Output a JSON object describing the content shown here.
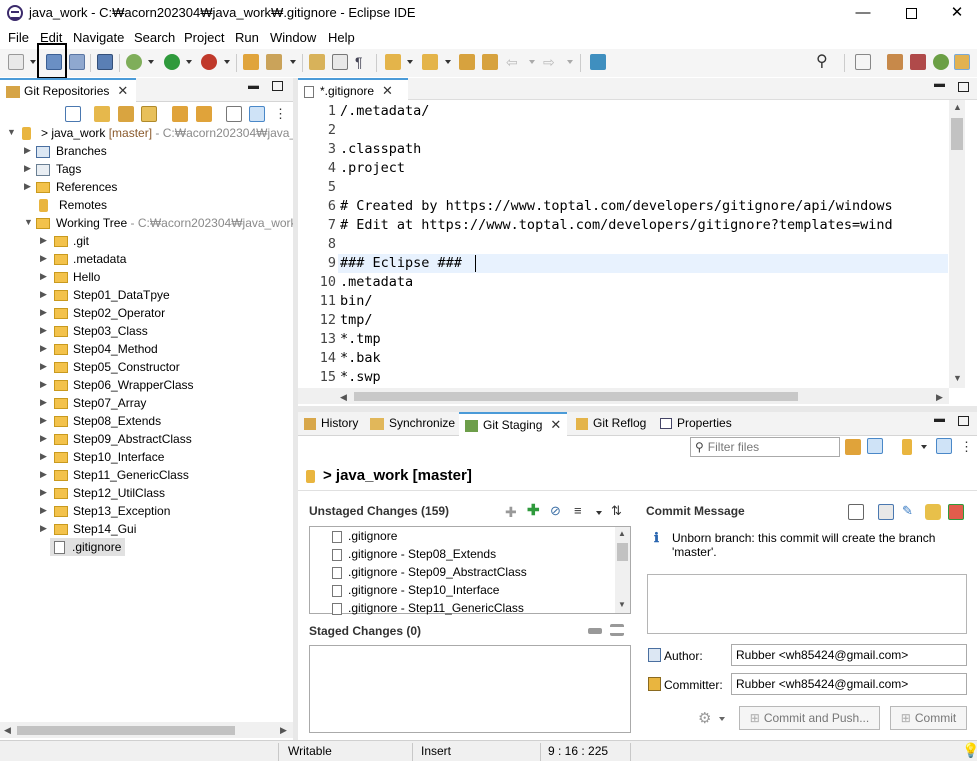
{
  "window": {
    "title": "java_work - C:₩acorn202304₩java_work₩.gitignore - Eclipse IDE"
  },
  "menu": [
    "File",
    "Edit",
    "Navigate",
    "Search",
    "Project",
    "Run",
    "Window",
    "Help"
  ],
  "left_panel": {
    "tab_label": "Git Repositories",
    "repo": {
      "name": "java_work",
      "branch": "[master]",
      "path": "- C:₩acorn202304₩java_"
    },
    "nodes": [
      {
        "label": "Branches"
      },
      {
        "label": "Tags"
      },
      {
        "label": "References"
      },
      {
        "label": "Remotes"
      }
    ],
    "working_tree": {
      "label": "Working Tree",
      "path": "- C:₩acorn202304₩java_work"
    },
    "folders": [
      ".git",
      ".metadata",
      "Hello",
      "Step01_DataTpye",
      "Step02_Operator",
      "Step03_Class",
      "Step04_Method",
      "Step05_Constructor",
      "Step06_WrapperClass",
      "Step07_Array",
      "Step08_Extends",
      "Step09_AbstractClass",
      "Step10_Interface",
      "Step11_GenericClass",
      "Step12_UtilClass",
      "Step13_Exception",
      "Step14_Gui"
    ],
    "selected_file": ".gitignore"
  },
  "editor": {
    "tab_label": "*.gitignore",
    "lines": [
      {
        "n": "1",
        "t": "/.metadata/"
      },
      {
        "n": "2",
        "t": ""
      },
      {
        "n": "3",
        "t": ".classpath"
      },
      {
        "n": "4",
        "t": ".project"
      },
      {
        "n": "5",
        "t": ""
      },
      {
        "n": "6",
        "t": "# Created by https://www.toptal.com/developers/gitignore/api/windows"
      },
      {
        "n": "7",
        "t": "# Edit at https://www.toptal.com/developers/gitignore?templates=wind"
      },
      {
        "n": "8",
        "t": ""
      },
      {
        "n": "9",
        "t": "### Eclipse ###"
      },
      {
        "n": "10",
        "t": ".metadata"
      },
      {
        "n": "11",
        "t": "bin/"
      },
      {
        "n": "12",
        "t": "tmp/"
      },
      {
        "n": "13",
        "t": "*.tmp"
      },
      {
        "n": "14",
        "t": "*.bak"
      },
      {
        "n": "15",
        "t": "*.swp"
      }
    ]
  },
  "bottom_tabs": [
    "History",
    "Synchronize",
    "Git Staging",
    "Git Reflog",
    "Properties"
  ],
  "staging": {
    "filter_placeholder": "Filter files",
    "repo_header": "> java_work [master]",
    "unstaged_title": "Unstaged Changes (159)",
    "unstaged_files": [
      ".gitignore",
      ".gitignore - Step08_Extends",
      ".gitignore - Step09_AbstractClass",
      ".gitignore - Step10_Interface",
      ".gitignore - Step11_GenericClass"
    ],
    "staged_title": "Staged Changes (0)",
    "commit_message_title": "Commit Message",
    "info": "Unborn branch: this commit will create the branch 'master'.",
    "author_label": "Author:",
    "author_value": "Rubber <wh85424@gmail.com>",
    "committer_label": "Committer:",
    "committer_value": "Rubber <wh85424@gmail.com>",
    "commit_push_label": "Commit and Push...",
    "commit_label": "Commit"
  },
  "status_bar": {
    "mode": "Writable",
    "insert": "Insert",
    "position": "9 : 16 : 225"
  }
}
